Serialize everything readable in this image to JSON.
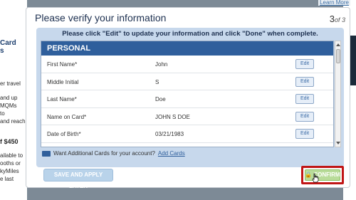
{
  "background": {
    "learn_more": "Learn More",
    "left_fragments": [
      "Card",
      "s",
      "er travel",
      "and up",
      "MQMs",
      "to",
      "and reach",
      "f $450",
      "ailable to",
      "ooths or",
      "kyMiles",
      "e last"
    ]
  },
  "modal": {
    "title": "Please verify your information",
    "step_current": "3",
    "step_of": "of 3",
    "instructions": "Please click \"Edit\" to update your information and click \"Done\" when complete.",
    "section_title": "PERSONAL",
    "rows": [
      {
        "label": "First Name*",
        "value": "John",
        "edit": "Edit"
      },
      {
        "label": "Middle Initial",
        "value": "S",
        "edit": "Edit"
      },
      {
        "label": "Last Name*",
        "value": "Doe",
        "edit": "Edit"
      },
      {
        "label": "Name on Card*",
        "value": "JOHN S DOE",
        "edit": "Edit"
      },
      {
        "label": "Date of Birth*",
        "value": "03/21/1983",
        "edit": "Edit"
      }
    ],
    "additional_cards_text": "Want Additional Cards for your account?",
    "add_cards_link": "Add Cards",
    "save_button": "SAVE AND APPLY LATER",
    "confirm_button": "CONFIRM",
    "highlight_color": "#c01515"
  }
}
